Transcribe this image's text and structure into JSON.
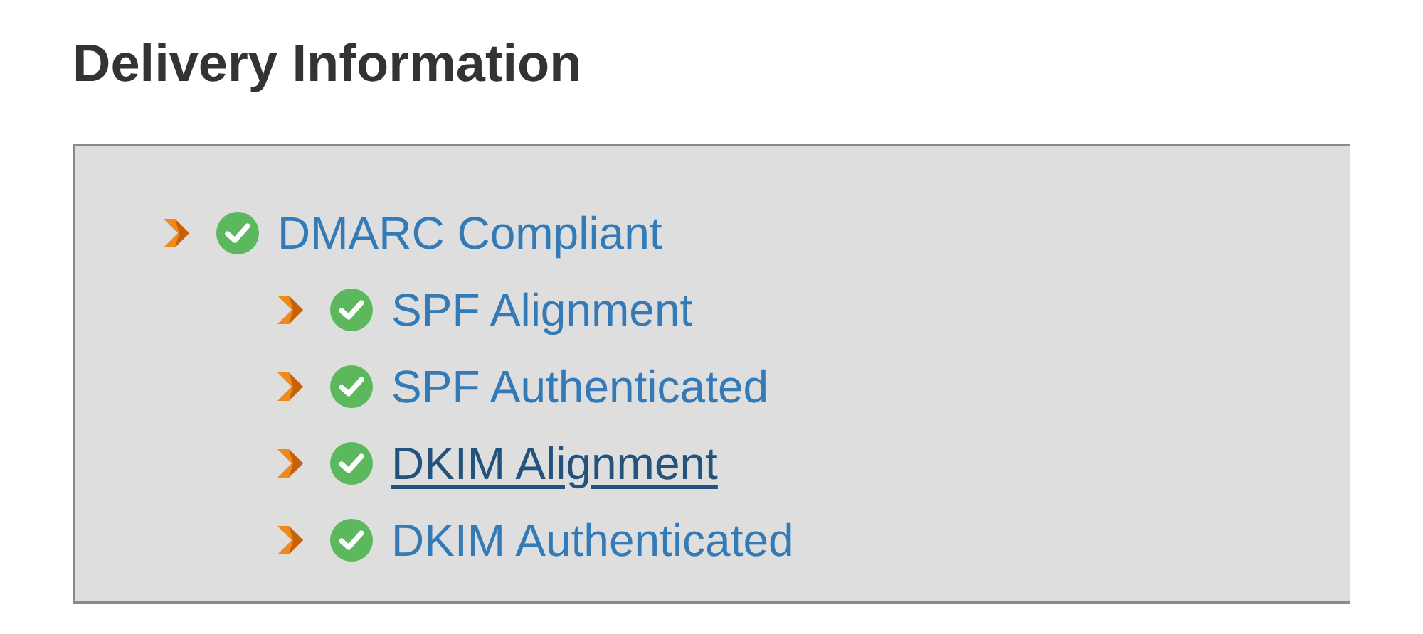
{
  "title": "Delivery Information",
  "tree": [
    {
      "label": "DMARC Compliant",
      "hovered": false,
      "children": [
        {
          "label": "SPF Alignment",
          "hovered": false
        },
        {
          "label": "SPF Authenticated",
          "hovered": false
        },
        {
          "label": "DKIM Alignment",
          "hovered": true
        },
        {
          "label": "DKIM Authenticated",
          "hovered": false
        }
      ]
    }
  ]
}
